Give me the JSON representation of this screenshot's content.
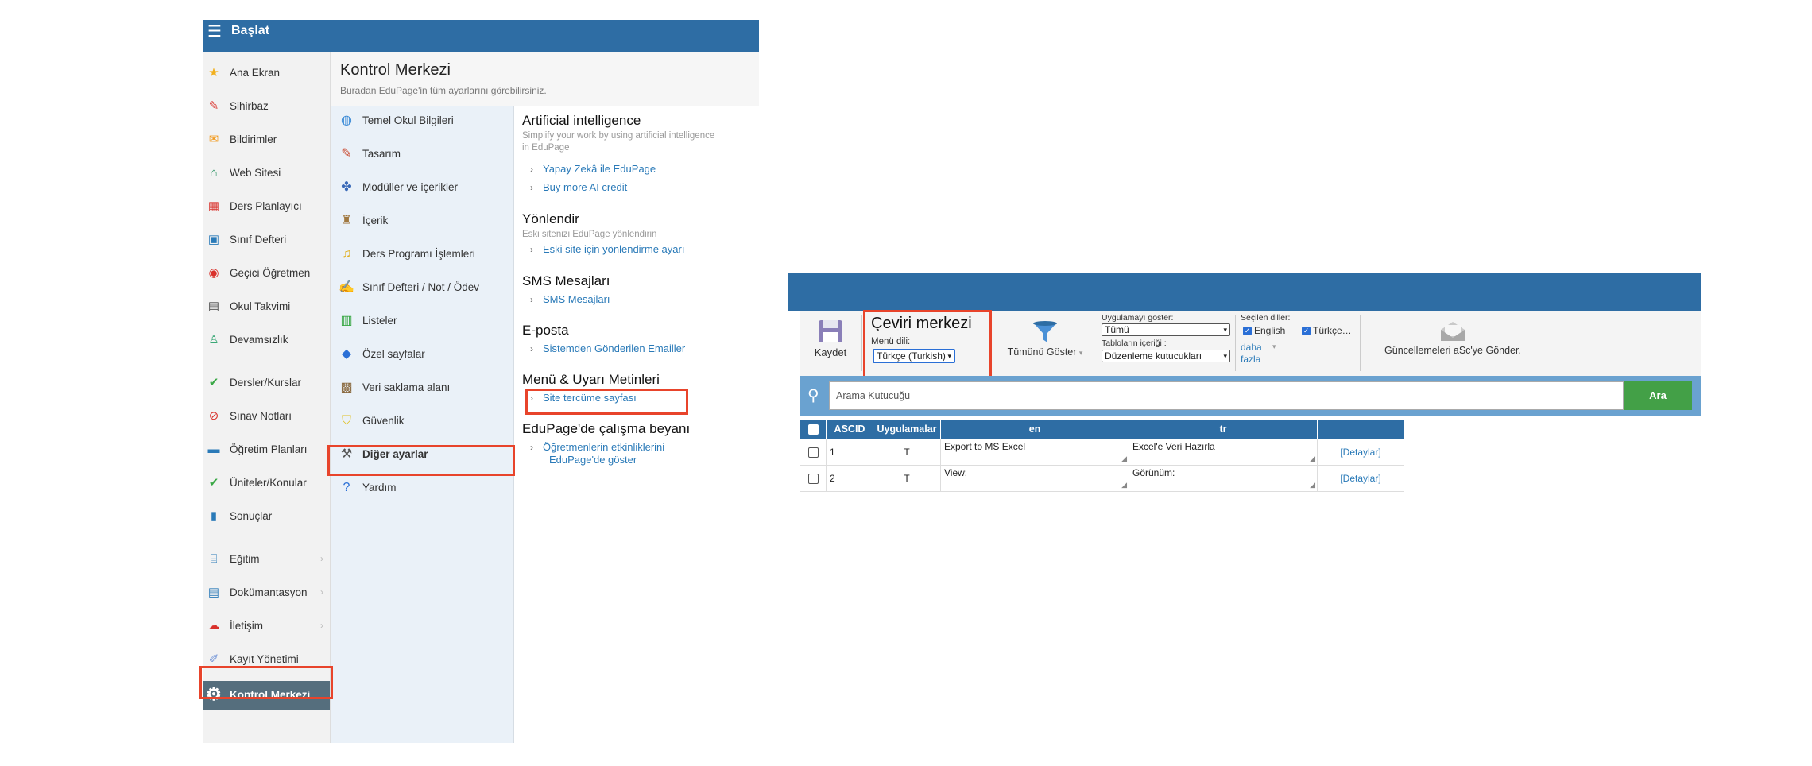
{
  "left": {
    "topbar": {
      "title": "Başlat"
    },
    "sidebar": {
      "items": [
        {
          "label": "Ana Ekran",
          "icon": "★",
          "color": "#f2b01e"
        },
        {
          "label": "Sihirbaz",
          "icon": "✎",
          "color": "#d9312b"
        },
        {
          "label": "Bildirimler",
          "icon": "✉",
          "color": "#f29a1e"
        },
        {
          "label": "Web Sitesi",
          "icon": "⌂",
          "color": "#1f8e5a"
        },
        {
          "label": "Ders Planlayıcı",
          "icon": "▦",
          "color": "#d9312b"
        },
        {
          "label": "Sınıf Defteri",
          "icon": "▣",
          "color": "#2a7ab8"
        },
        {
          "label": "Geçici Öğretmen",
          "icon": "◉",
          "color": "#d9312b"
        },
        {
          "label": "Okul Takvimi",
          "icon": "▤",
          "color": "#444444"
        },
        {
          "label": "Devamsızlık",
          "icon": "♙",
          "color": "#3aa876"
        },
        {
          "label": "Dersler/Kurslar",
          "icon": "✔",
          "color": "#3aa846"
        },
        {
          "label": "Sınav Notları",
          "icon": "⊘",
          "color": "#d9312b"
        },
        {
          "label": "Öğretim Planları",
          "icon": "▬",
          "color": "#2a7ab8"
        },
        {
          "label": "Üniteler/Konular",
          "icon": "✔",
          "color": "#3aa846"
        },
        {
          "label": "Sonuçlar",
          "icon": "▮",
          "color": "#2a7ab8"
        },
        {
          "label": "Eğitim",
          "icon": "⌸",
          "color": "#2a7ab8",
          "arrow": "›"
        },
        {
          "label": "Dokümantasyon",
          "icon": "▤",
          "color": "#2a7ab8",
          "arrow": "›"
        },
        {
          "label": "İletişim",
          "icon": "☁",
          "color": "#d9312b",
          "arrow": "›"
        },
        {
          "label": "Kayıt Yönetimi",
          "icon": "✐",
          "color": "#6b8fd6"
        },
        {
          "label": "Kontrol Merkezi",
          "icon": "⚙",
          "color": "#ffffff"
        }
      ]
    },
    "header": {
      "title": "Kontrol Merkezi",
      "subtitle": "Buradan EduPage'in tüm ayarlarını görebilirsiniz."
    },
    "menu": {
      "items": [
        {
          "label": "Temel Okul Bilgileri",
          "icon": "◍"
        },
        {
          "label": "Tasarım",
          "icon": "✎"
        },
        {
          "label": "Modüller ve içerikler",
          "icon": "✤"
        },
        {
          "label": "İçerik",
          "icon": "♜"
        },
        {
          "label": "Ders Programı İşlemleri",
          "icon": "♫"
        },
        {
          "label": "Sınıf Defteri / Not / Ödev",
          "icon": "✍"
        },
        {
          "label": "Listeler",
          "icon": "▥"
        },
        {
          "label": "Özel sayfalar",
          "icon": "◆"
        },
        {
          "label": "Veri saklama alanı",
          "icon": "▩"
        },
        {
          "label": "Güvenlik",
          "icon": "⛉"
        },
        {
          "label": "Diğer ayarlar",
          "icon": "⚒"
        },
        {
          "label": "Yardım",
          "icon": "?"
        }
      ]
    },
    "sections": {
      "ai": {
        "title": "Artificial intelligence",
        "desc": "Simplify your work by using artificial intelligence in EduPage",
        "links": [
          "Yapay Zekâ ile EduPage",
          "Buy more AI credit"
        ]
      },
      "redirect": {
        "title": "Yönlendir",
        "desc": "Eski sitenizi EduPage yönlendirin",
        "links": [
          "Eski site için yönlendirme ayarı"
        ]
      },
      "sms": {
        "title": "SMS Mesajları",
        "links": [
          "SMS Mesajları"
        ]
      },
      "email": {
        "title": "E-posta",
        "links": [
          "Sistemden Gönderilen Emailler"
        ]
      },
      "menu_texts": {
        "title": "Menü & Uyarı Metinleri",
        "links": [
          "Site tercüme sayfası"
        ]
      },
      "statement": {
        "title": "EduPage'de çalışma beyanı",
        "link_line1": "Öğretmenlerin etkinliklerini",
        "link_line2": "EduPage'de göster"
      }
    }
  },
  "panel": {
    "toolbar": {
      "save_label": "Kaydet",
      "center_title": "Çeviri merkezi",
      "menu_lang_label": "Menü dili:",
      "menu_lang_value": "Türkçe (Turkish)",
      "show_all_label": "Tümünü Göster",
      "app_show_label": "Uygulamayı göster:",
      "app_show_value": "Tümü",
      "table_content_label": "Tabloların içeriği :",
      "table_content_value": "Düzenleme kutucukları",
      "selected_langs_label": "Seçilen diller:",
      "lang_en": "English",
      "lang_tr": "Türkçe…",
      "more_line1": "daha",
      "more_line2": "fazla",
      "send_updates_label": "Güncellemeleri aSc'ye Gönder."
    },
    "search": {
      "placeholder": "Arama Kutucuğu",
      "button": "Ara"
    },
    "table": {
      "headers": [
        "ASCID",
        "Uygulamalar",
        "en",
        "tr"
      ],
      "rows": [
        {
          "ascid": "1",
          "app": "T",
          "en": "Export to MS Excel",
          "tr": "Excel'e Veri Hazırla",
          "details": "[Detaylar]"
        },
        {
          "ascid": "2",
          "app": "T",
          "en": "View:",
          "tr": "Görünüm:",
          "details": "[Detaylar]"
        }
      ]
    }
  }
}
